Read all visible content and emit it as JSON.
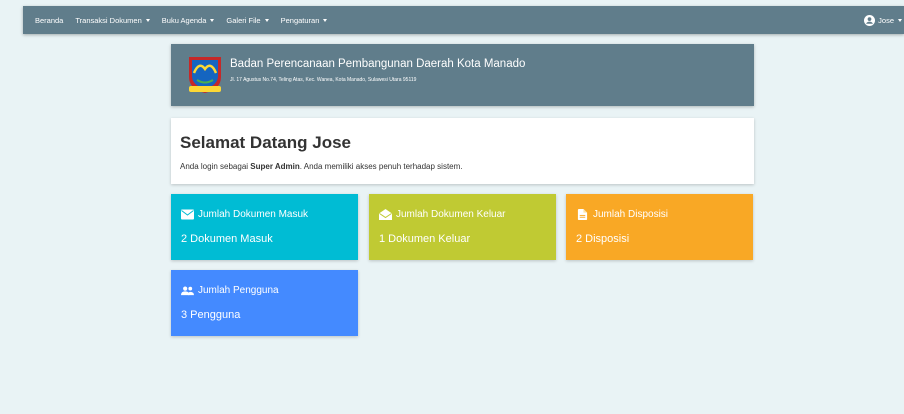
{
  "navbar": {
    "items": [
      {
        "label": "Beranda",
        "dropdown": false
      },
      {
        "label": "Transaksi Dokumen",
        "dropdown": true
      },
      {
        "label": "Buku Agenda",
        "dropdown": true
      },
      {
        "label": "Galeri File",
        "dropdown": true
      },
      {
        "label": "Pengaturan",
        "dropdown": true
      }
    ],
    "user": {
      "label": "Jose",
      "icon": "user-circle-icon"
    }
  },
  "header": {
    "org_name": "Badan Perencanaan Pembangunan Daerah Kota Manado",
    "address": "Jl. 17 Agustus No.74, Teling Atas, Kec. Wanea, Kota Manado, Sulawesi Utara 95119",
    "logo": "manado-crest-logo"
  },
  "welcome": {
    "title": "Selamat Datang Jose",
    "text_before": "Anda login sebagai ",
    "role": "Super Admin",
    "text_after": ". Anda memiliki akses penuh terhadap sistem."
  },
  "cards": {
    "masuk": {
      "title": "Jumlah Dokumen Masuk",
      "value": "2 Dokumen Masuk",
      "icon": "envelope-icon",
      "color": "#00bcd4"
    },
    "keluar": {
      "title": "Jumlah Dokumen Keluar",
      "value": "1 Dokumen Keluar",
      "icon": "envelope-open-icon",
      "color": "#c0ca33"
    },
    "disposisi": {
      "title": "Jumlah Disposisi",
      "value": "2 Disposisi",
      "icon": "document-icon",
      "color": "#f9a825"
    },
    "pengguna": {
      "title": "Jumlah Pengguna",
      "value": "3 Pengguna",
      "icon": "people-icon",
      "color": "#448aff"
    }
  },
  "colors": {
    "navbar": "#607d8b",
    "background": "#e9f3f5"
  }
}
